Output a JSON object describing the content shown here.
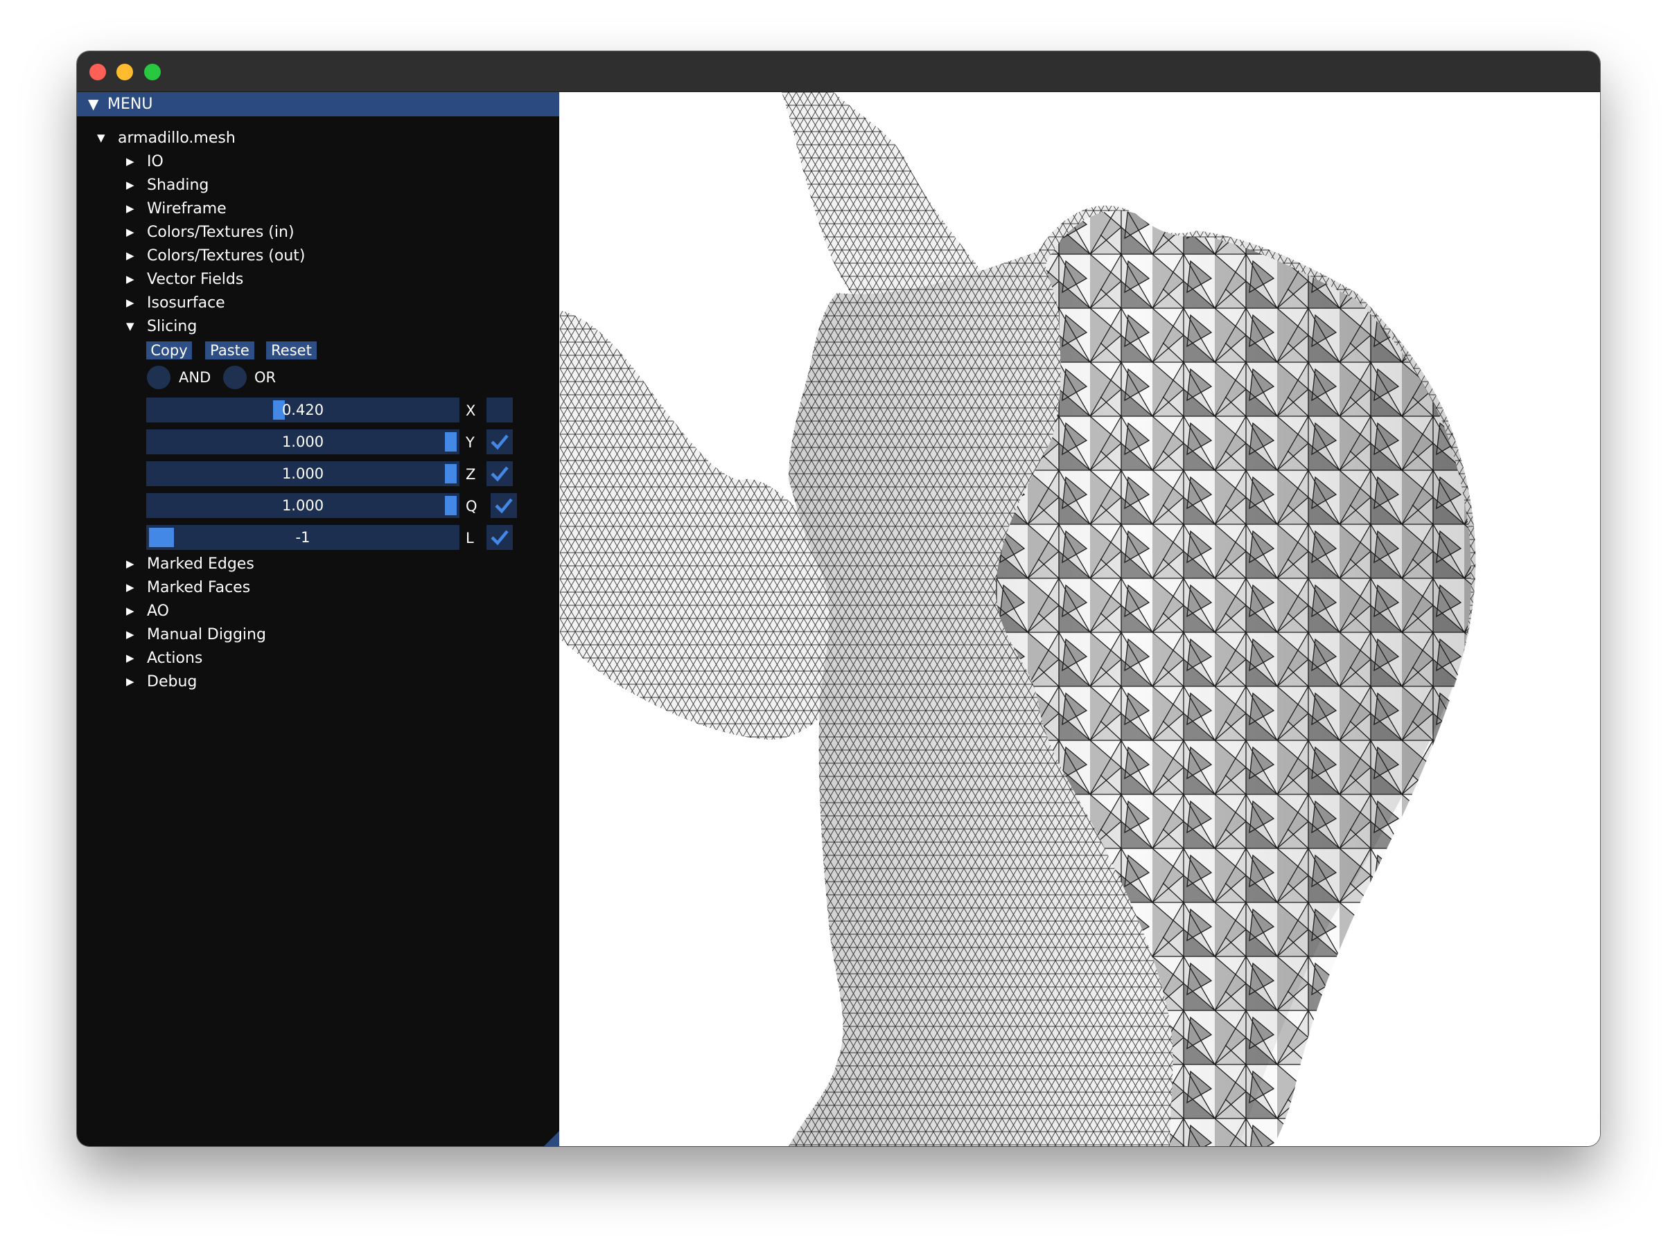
{
  "menu": {
    "title": "MENU",
    "root": "armadillo.mesh",
    "sections_top": [
      "IO",
      "Shading",
      "Wireframe",
      "Colors/Textures (in)",
      "Colors/Textures (out)",
      "Vector Fields",
      "Isosurface"
    ],
    "open_section": "Slicing",
    "sections_bottom": [
      "Marked Edges",
      "Marked Faces",
      "AO",
      "Manual Digging",
      "Actions",
      "Debug"
    ]
  },
  "slicing": {
    "buttons": {
      "copy": "Copy",
      "paste": "Paste",
      "reset": "Reset"
    },
    "logic": {
      "and": "AND",
      "or": "OR"
    },
    "sliders": [
      {
        "axis": "X",
        "value": "0.420",
        "fraction": 0.42,
        "checked": false
      },
      {
        "axis": "Y",
        "value": "1.000",
        "fraction": 1.0,
        "checked": true
      },
      {
        "axis": "Z",
        "value": "1.000",
        "fraction": 1.0,
        "checked": true
      },
      {
        "axis": "Q",
        "value": "1.000",
        "fraction": 1.0,
        "checked": true
      },
      {
        "axis": "L",
        "value": "-1",
        "fraction": 0.0,
        "checked": true
      }
    ]
  },
  "colors": {
    "menu_header": "#2a4a80",
    "panel_bg": "#0e0e0e",
    "slider_bg": "#1c2f50",
    "accent": "#4488e6"
  }
}
